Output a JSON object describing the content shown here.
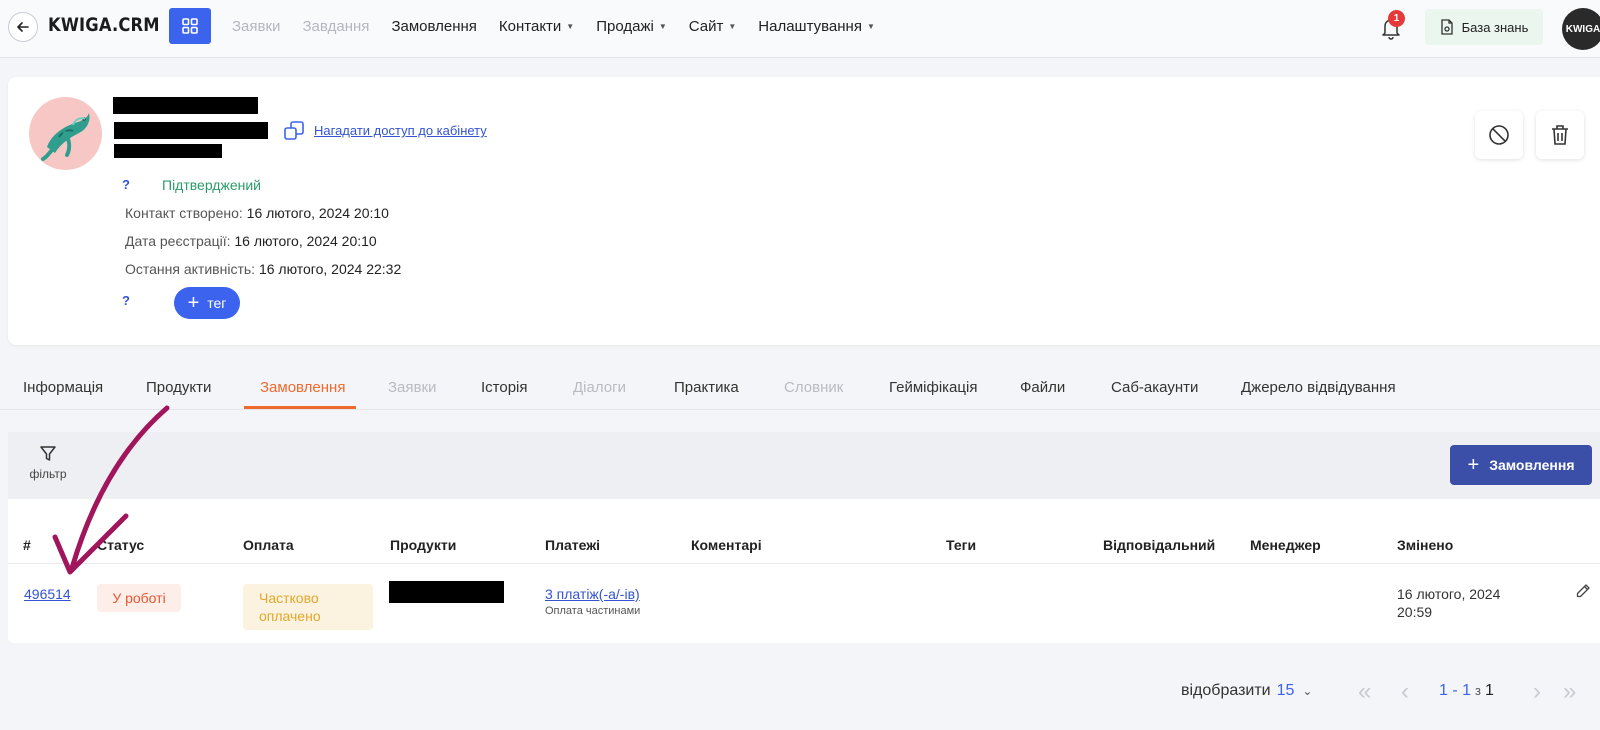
{
  "header": {
    "logo": "KWIGA.CRM",
    "nav": [
      {
        "label": "Заявки",
        "disabled": true,
        "dropdown": false
      },
      {
        "label": "Завдання",
        "disabled": true,
        "dropdown": false
      },
      {
        "label": "Замовлення",
        "disabled": false,
        "dropdown": false
      },
      {
        "label": "Контакти",
        "disabled": false,
        "dropdown": true
      },
      {
        "label": "Продажі",
        "disabled": false,
        "dropdown": true
      },
      {
        "label": "Сайт",
        "disabled": false,
        "dropdown": true
      },
      {
        "label": "Налаштування",
        "disabled": false,
        "dropdown": true
      }
    ],
    "notifications_count": "1",
    "knowledge_base": "База знань",
    "avatar_text": "KWIGA"
  },
  "profile": {
    "remind_link": "Нагадати доступ до кабінету",
    "help_mark": "?",
    "status": "Підтверджений",
    "created_label": "Контакт створено:",
    "created_value": "16 лютого, 2024 20:10",
    "registered_label": "Дата реєстрації:",
    "registered_value": "16 лютого, 2024 20:10",
    "activity_label": "Остання активність:",
    "activity_value": "16 лютого, 2024 22:32",
    "tag_button": "тег"
  },
  "tabs": [
    {
      "label": "Інформація",
      "state": "normal"
    },
    {
      "label": "Продукти",
      "state": "normal"
    },
    {
      "label": "Замовлення",
      "state": "active"
    },
    {
      "label": "Заявки",
      "state": "disabled"
    },
    {
      "label": "Історія",
      "state": "normal"
    },
    {
      "label": "Діалоги",
      "state": "disabled"
    },
    {
      "label": "Практика",
      "state": "normal"
    },
    {
      "label": "Словник",
      "state": "disabled"
    },
    {
      "label": "Гейміфікація",
      "state": "normal"
    },
    {
      "label": "Файли",
      "state": "normal"
    },
    {
      "label": "Саб-акаунти",
      "state": "normal"
    },
    {
      "label": "Джерело відвідування",
      "state": "normal"
    }
  ],
  "toolbar": {
    "filter_label": "фільтр",
    "add_order": "Замовлення"
  },
  "table": {
    "columns": [
      "#",
      "Статус",
      "Оплата",
      "Продукти",
      "Платежі",
      "Коментарі",
      "Теги",
      "Відповідальний",
      "Менеджер",
      "Змінено"
    ],
    "rows": [
      {
        "id": "496514",
        "status": "У роботі",
        "payment_line1": "Частково",
        "payment_line2": "оплачено",
        "payments_link": "3 платіж(-а/-ів)",
        "payments_note": "Оплата частинами",
        "changed_line1": "16 лютого, 2024",
        "changed_line2": "20:59"
      }
    ]
  },
  "pagination": {
    "show_label": "відобразити",
    "per_page": "15",
    "range": "1 - 1",
    "of": "з",
    "total": "1"
  },
  "colors": {
    "accent": "#3b63ee",
    "active_tab": "#ee6a2f",
    "status_text": "#e4572e",
    "payment_text": "#e3a72b",
    "annotation_arrow": "#a0155c"
  }
}
